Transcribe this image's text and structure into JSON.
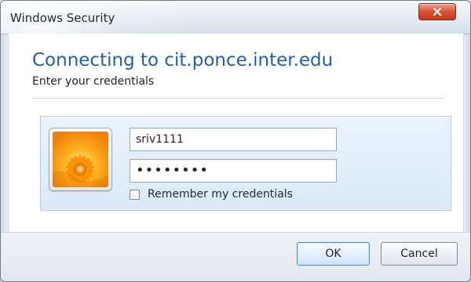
{
  "window": {
    "title": "Windows Security",
    "close_icon": "close-icon"
  },
  "dialog": {
    "heading": "Connecting to cit.ponce.inter.edu",
    "subheading": "Enter your credentials"
  },
  "credentials": {
    "avatar_icon": "flower-user-tile",
    "username_value": "sriv1111",
    "password_value": "••••••••",
    "remember_label": "Remember my credentials",
    "remember_checked": false
  },
  "buttons": {
    "ok_label": "OK",
    "cancel_label": "Cancel"
  },
  "colors": {
    "heading": "#1f5fae",
    "close_button": "#d95335",
    "panel": "#dbe9f8"
  }
}
